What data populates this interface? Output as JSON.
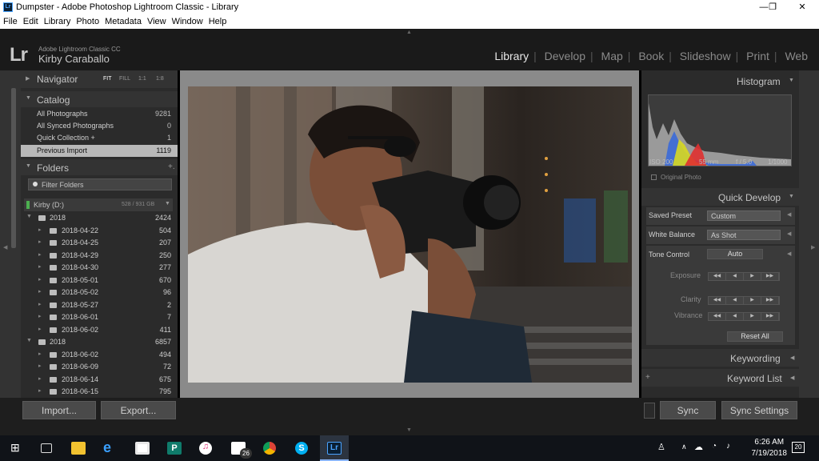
{
  "window": {
    "title": "Dumpster - Adobe Photoshop Lightroom Classic - Library",
    "app_icon": "Lr",
    "minimize": "—",
    "maximize": "❐",
    "close": "✕"
  },
  "menu": [
    "File",
    "Edit",
    "Library",
    "Photo",
    "Metadata",
    "View",
    "Window",
    "Help"
  ],
  "identity": {
    "logo": "Lr",
    "product": "Adobe Lightroom Classic CC",
    "user": "Kirby Caraballo"
  },
  "modules": [
    "Library",
    "Develop",
    "Map",
    "Book",
    "Slideshow",
    "Print",
    "Web"
  ],
  "active_module": "Library",
  "navigator": {
    "title": "Navigator",
    "zoom": [
      "FIT",
      "FILL",
      "1:1",
      "1:8"
    ],
    "active_zoom": "FIT"
  },
  "catalog": {
    "title": "Catalog",
    "items": [
      {
        "label": "All Photographs",
        "count": "9281"
      },
      {
        "label": "All Synced Photographs",
        "count": "0"
      },
      {
        "label": "Quick Collection +",
        "count": "1"
      },
      {
        "label": "Previous Import",
        "count": "1119"
      }
    ]
  },
  "folders": {
    "title": "Folders",
    "add": "+.",
    "filter_placeholder": "Filter Folders",
    "volume": {
      "name": "Kirby (D:)",
      "usage": "528 / 931 GB"
    },
    "items": [
      {
        "label": "2018",
        "count": "2424",
        "level": 0
      },
      {
        "label": "2018-04-22",
        "count": "504",
        "level": 1
      },
      {
        "label": "2018-04-25",
        "count": "207",
        "level": 1
      },
      {
        "label": "2018-04-29",
        "count": "250",
        "level": 1
      },
      {
        "label": "2018-04-30",
        "count": "277",
        "level": 1
      },
      {
        "label": "2018-05-01",
        "count": "670",
        "level": 1
      },
      {
        "label": "2018-05-02",
        "count": "96",
        "level": 1
      },
      {
        "label": "2018-05-27",
        "count": "2",
        "level": 1
      },
      {
        "label": "2018-06-01",
        "count": "7",
        "level": 1
      },
      {
        "label": "2018-06-02",
        "count": "411",
        "level": 1
      },
      {
        "label": "2018",
        "count": "6857",
        "level": 0
      },
      {
        "label": "2018-06-02",
        "count": "494",
        "level": 1
      },
      {
        "label": "2018-06-09",
        "count": "72",
        "level": 1
      },
      {
        "label": "2018-06-14",
        "count": "675",
        "level": 1
      },
      {
        "label": "2018-06-15",
        "count": "795",
        "level": 1
      }
    ]
  },
  "left_buttons": {
    "import": "Import...",
    "export": "Export..."
  },
  "histogram": {
    "title": "Histogram",
    "iso": "ISO 200",
    "focal": "55 mm",
    "aperture": "f / 5.0",
    "shutter": "1/1000",
    "original_photo": "Original Photo"
  },
  "quick_develop": {
    "title": "Quick Develop",
    "saved_preset_label": "Saved Preset",
    "saved_preset_value": "Custom",
    "white_balance_label": "White Balance",
    "white_balance_value": "As Shot",
    "tone_control_label": "Tone Control",
    "auto": "Auto",
    "exposure": "Exposure",
    "clarity": "Clarity",
    "vibrance": "Vibrance",
    "reset": "Reset All"
  },
  "right_sections": {
    "keywording": "Keywording",
    "keyword_list": "Keyword List"
  },
  "sync": {
    "sync": "Sync",
    "sync_settings": "Sync Settings"
  },
  "toolbar": {
    "stars": "★★★★★"
  },
  "clock": {
    "time": "6:26 AM",
    "date": "7/19/2018"
  },
  "taskbar_badges": {
    "mail": "26",
    "notifications": "20"
  }
}
